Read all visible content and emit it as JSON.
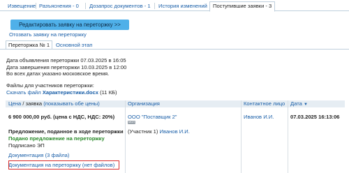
{
  "tabs": [
    "Извещение",
    "Разъяснения - 0",
    "Дозапрос документов - 1",
    "История изменений",
    "Поступившие заявки - 3"
  ],
  "edit_button": "Редактировать заявку на переторжку >>",
  "withdraw_link": "Отозвать заявку на переторжку",
  "subtabs": [
    "Переторжка № 1",
    "Основной этап"
  ],
  "info": {
    "announce": "Дата объявления переторжки 07.03.2025 в 16:05",
    "end": "Дата завершения переторжки 10.03.2025 в 12:00",
    "tz": "Во всех датах указано московское время."
  },
  "files": {
    "heading": "Файлы для участников переторжки:",
    "download_prefix": "Скачать файл ",
    "file_name": "Характеристики.docx",
    "file_size": " (11 КБ)"
  },
  "table": {
    "col_price_a": "Цена",
    "col_price_b": " / заявка ",
    "col_price_c": "(показывать обе цены)",
    "col_org": "Организация",
    "col_contact": "Контактное лицо",
    "col_date": "Дата",
    "sort_icon": "▼",
    "row": {
      "price": "6 900 000,00 руб. (цена с НДС, НДС: 20%)",
      "offer_title": "Предложение, поданное в ходе переторжки",
      "status": "Подано предложение на переторжку",
      "signed": "Подписано ЭП",
      "docs": "Документация (3 файла)",
      "docs_rebid": "Документация на переторжку (нет файлов)",
      "org": "ООО \"Поставщик 2\"",
      "org_badge": "МСП",
      "participant_prefix": "(Участник 1) ",
      "participant_name": "Иванов И.И.",
      "contact": "Иванов И.И.",
      "date": "07.03.2025 16:13:06"
    }
  }
}
